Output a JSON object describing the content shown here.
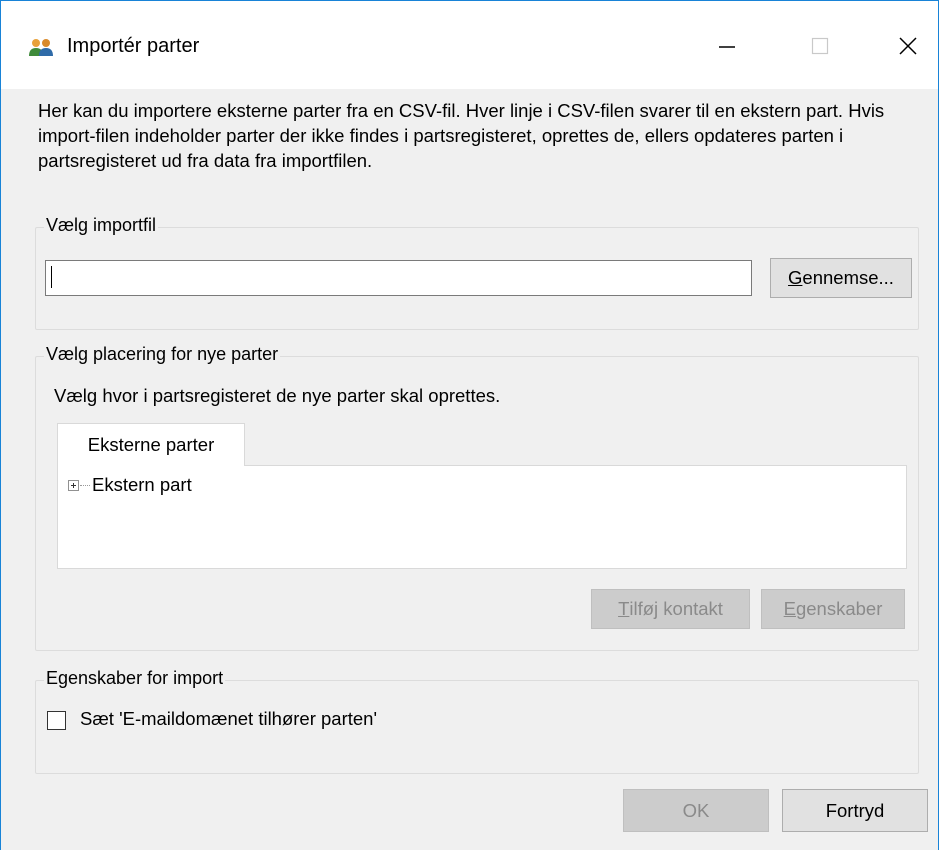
{
  "window": {
    "title": "Importér parter",
    "icon": "people-icon",
    "controls": {
      "minimize": "minimize-icon",
      "maximize": "maximize-icon",
      "close": "close-icon"
    }
  },
  "description": "Her kan du importere eksterne parter fra en CSV-fil. Hver linje i CSV-filen svarer til en ekstern part. Hvis import-filen indeholder parter der ikke findes i partsregisteret, oprettes de, ellers opdateres parten i partsregisteret ud fra data fra importfilen.",
  "import_file": {
    "legend": "Vælg importfil",
    "value": "",
    "browse_label_underlined": "G",
    "browse_label_rest": "ennemse..."
  },
  "placement": {
    "legend": "Vælg placering for nye parter",
    "hint": "Vælg hvor i partsregisteret de nye parter skal oprettes.",
    "tab_label": "Eksterne parter",
    "tree_items": [
      {
        "label": "Ekstern part",
        "expanded": false
      }
    ],
    "add_contact_underlined": "T",
    "add_contact_rest": "ilføj kontakt",
    "properties_underlined": "E",
    "properties_rest": "genskaber"
  },
  "import_options": {
    "legend": "Egenskaber for import",
    "checkbox_label": "Sæt 'E-maildomænet tilhører parten'",
    "checked": false
  },
  "footer": {
    "ok_label": "OK",
    "cancel_label": "Fortryd"
  },
  "colors": {
    "accent_border": "#1883d7",
    "dialog_bg": "#f0f0f0",
    "disabled_text": "#8a8a8a"
  }
}
